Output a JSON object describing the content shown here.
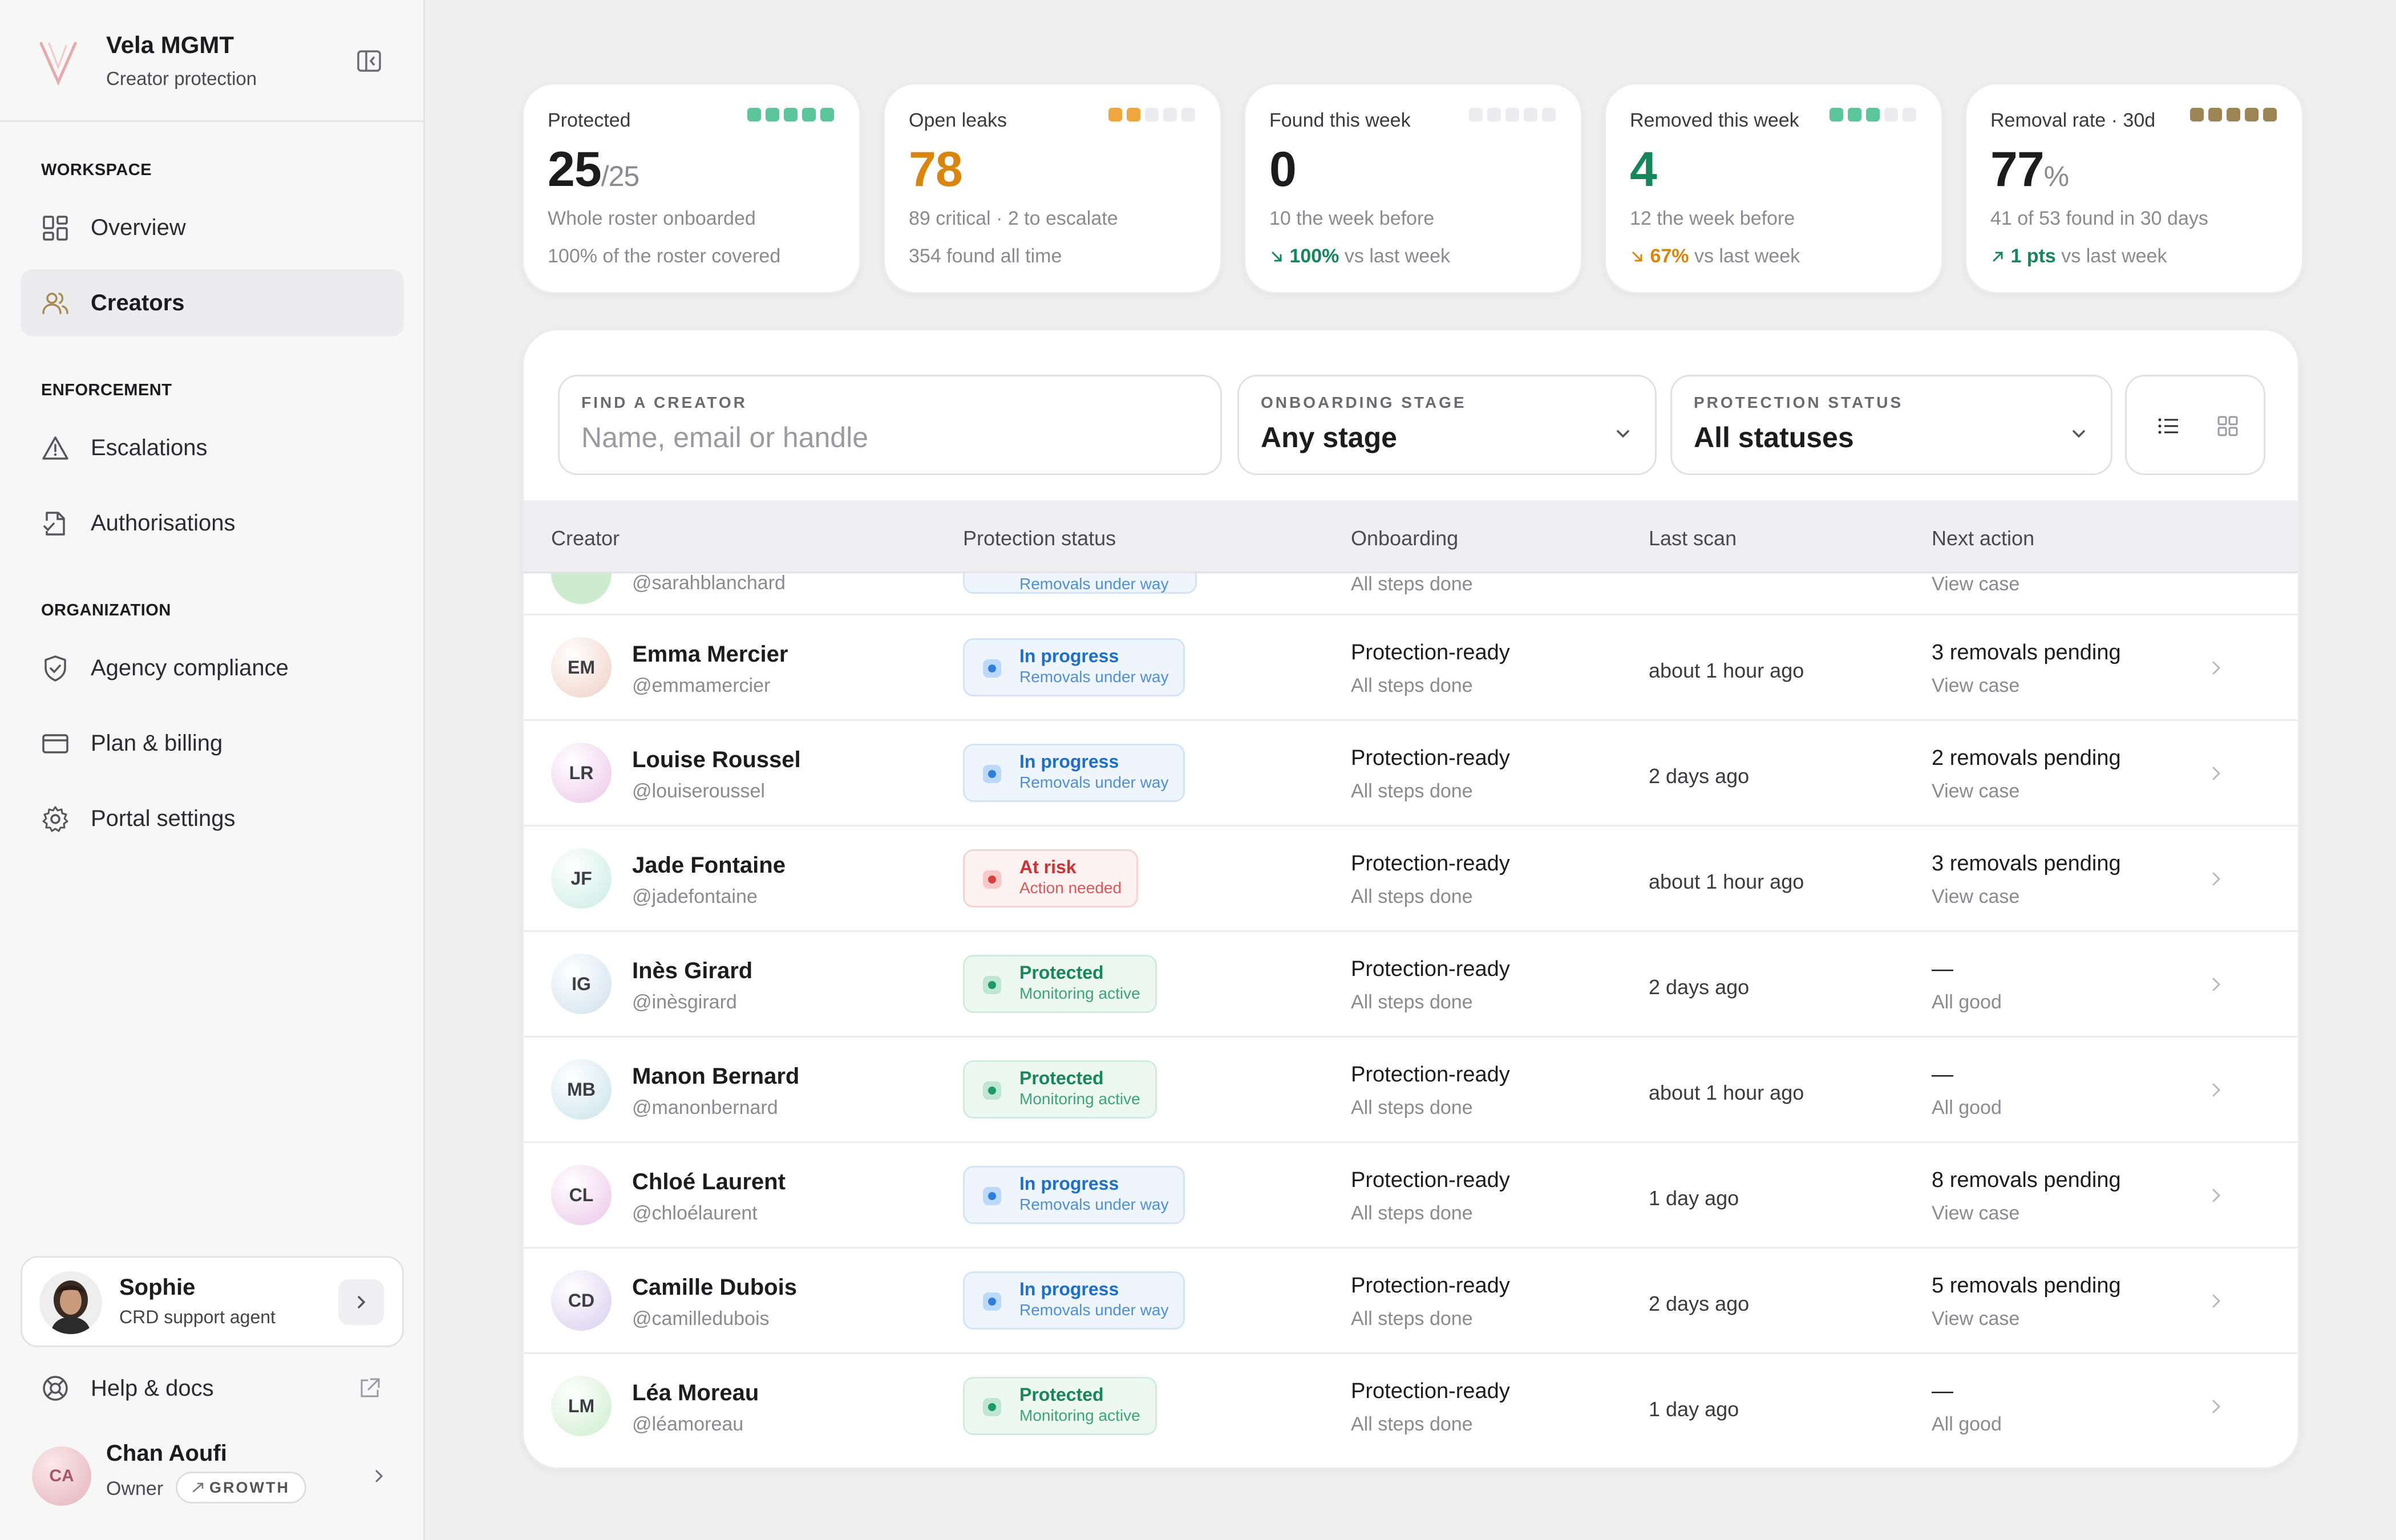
{
  "brand": {
    "name": "Vela MGMT",
    "subtitle": "Creator protection"
  },
  "nav": {
    "workspace_label": "WORKSPACE",
    "overview": "Overview",
    "creators": "Creators",
    "enforcement_label": "ENFORCEMENT",
    "escalations": "Escalations",
    "authorisations": "Authorisations",
    "organization_label": "ORGANIZATION",
    "agency_compliance": "Agency compliance",
    "plan_billing": "Plan & billing",
    "portal_settings": "Portal settings"
  },
  "agent": {
    "name": "Sophie",
    "role": "CRD support agent"
  },
  "help": {
    "label": "Help & docs"
  },
  "user": {
    "initials": "CA",
    "name": "Chan Aoufi",
    "role": "Owner",
    "plan": "GROWTH"
  },
  "kpis": [
    {
      "label": "Protected",
      "value": "25",
      "suffix": "/25",
      "line1": "Whole roster onboarded",
      "line2": "100% of the roster covered",
      "dots_filled": 5,
      "dot_color": "#5cc69a"
    },
    {
      "label": "Open leaks",
      "value": "78",
      "line1": "89 critical · 2 to escalate",
      "line2": "354 found all time",
      "dots_filled": 2,
      "dot_color": "#f0a640"
    },
    {
      "label": "Found this week",
      "value": "0",
      "line1": "10 the week before",
      "trend": "100%",
      "trend_dir": "down",
      "trend_text": "vs last week",
      "dots_filled": 0,
      "dot_color": "#5cc69a"
    },
    {
      "label": "Removed this week",
      "value": "4",
      "line1": "12 the week before",
      "trend": "67%",
      "trend_dir": "down",
      "trend_text": "vs last week",
      "dots_filled": 3,
      "dot_color": "#5cc69a"
    },
    {
      "label": "Removal rate · 30d",
      "value": "77",
      "suffix": "%",
      "line1": "41 of 53 found in 30 days",
      "trend": "1 pts",
      "trend_dir": "up",
      "trend_text": "vs last week",
      "dots_filled": 5,
      "dot_color": "#9c8455"
    }
  ],
  "filters": {
    "search_label": "FIND A CREATOR",
    "search_placeholder": "Name, email or handle",
    "stage_label": "ONBOARDING STAGE",
    "stage_value": "Any stage",
    "status_label": "PROTECTION STATUS",
    "status_value": "All statuses"
  },
  "table": {
    "headers": [
      "Creator",
      "Protection status",
      "Onboarding",
      "Last scan",
      "Next action"
    ],
    "ghost": {
      "handle": "@sarahblanchard",
      "status2": "Removals under way",
      "onb2": "All steps done",
      "next2": "View case"
    },
    "rows": [
      {
        "initials": "EM",
        "name": "Emma Mercier",
        "handle": "@emmamercier",
        "status": "progress",
        "status1": "In progress",
        "status2": "Removals under way",
        "onb1": "Protection-ready",
        "onb2": "All steps done",
        "scan": "about 1 hour ago",
        "next1": "3 removals pending",
        "next2": "View case",
        "avatar_bg": "#f0cfc4"
      },
      {
        "initials": "LR",
        "name": "Louise Roussel",
        "handle": "@louiseroussel",
        "status": "progress",
        "status1": "In progress",
        "status2": "Removals under way",
        "onb1": "Protection-ready",
        "onb2": "All steps done",
        "scan": "2 days ago",
        "next1": "2 removals pending",
        "next2": "View case",
        "avatar_bg": "#ecc6ea"
      },
      {
        "initials": "JF",
        "name": "Jade Fontaine",
        "handle": "@jadefontaine",
        "status": "risk",
        "status1": "At risk",
        "status2": "Action needed",
        "onb1": "Protection-ready",
        "onb2": "All steps done",
        "scan": "about 1 hour ago",
        "next1": "3 removals pending",
        "next2": "View case",
        "avatar_bg": "#c9ece2"
      },
      {
        "initials": "IG",
        "name": "Inès Girard",
        "handle": "@inèsgirard",
        "status": "protected",
        "status1": "Protected",
        "status2": "Monitoring active",
        "onb1": "Protection-ready",
        "onb2": "All steps done",
        "scan": "2 days ago",
        "next1": "—",
        "next2": "All good",
        "avatar_bg": "#cfe0ee"
      },
      {
        "initials": "MB",
        "name": "Manon Bernard",
        "handle": "@manonbernard",
        "status": "protected",
        "status1": "Protected",
        "status2": "Monitoring active",
        "onb1": "Protection-ready",
        "onb2": "All steps done",
        "scan": "about 1 hour ago",
        "next1": "—",
        "next2": "All good",
        "avatar_bg": "#c9e3ec"
      },
      {
        "initials": "CL",
        "name": "Chloé Laurent",
        "handle": "@chloélaurent",
        "status": "progress",
        "status1": "In progress",
        "status2": "Removals under way",
        "onb1": "Protection-ready",
        "onb2": "All steps done",
        "scan": "1 day ago",
        "next1": "8 removals pending",
        "next2": "View case",
        "avatar_bg": "#ecc6ea"
      },
      {
        "initials": "CD",
        "name": "Camille Dubois",
        "handle": "@camilledubois",
        "status": "progress",
        "status1": "In progress",
        "status2": "Removals under way",
        "onb1": "Protection-ready",
        "onb2": "All steps done",
        "scan": "2 days ago",
        "next1": "5 removals pending",
        "next2": "View case",
        "avatar_bg": "#d8cdee"
      },
      {
        "initials": "LM",
        "name": "Léa Moreau",
        "handle": "@léamoreau",
        "status": "protected",
        "status1": "Protected",
        "status2": "Monitoring active",
        "onb1": "Protection-ready",
        "onb2": "All steps done",
        "scan": "1 day ago",
        "next1": "—",
        "next2": "All good",
        "avatar_bg": "#cdeccd"
      }
    ]
  }
}
